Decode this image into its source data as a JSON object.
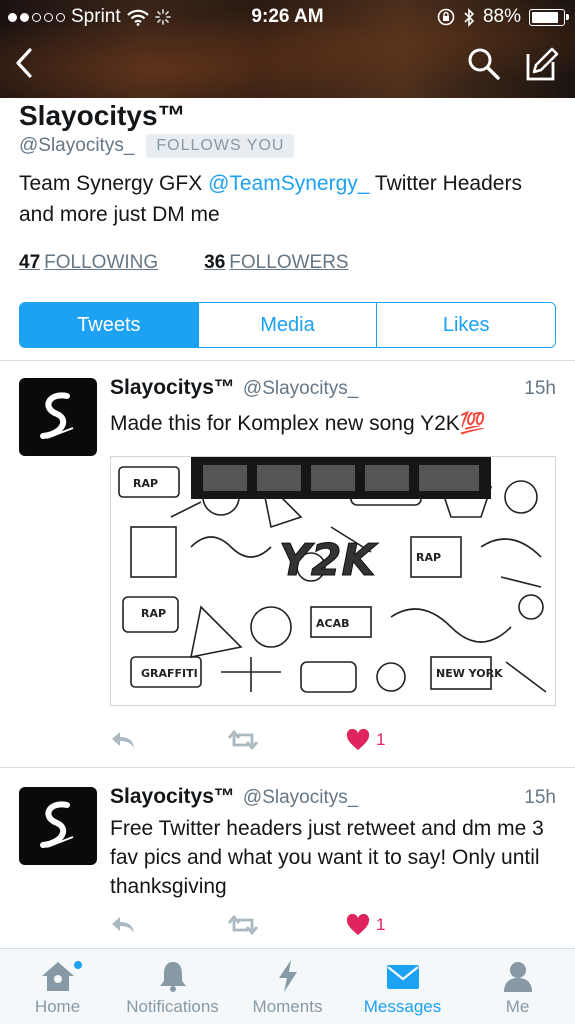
{
  "status_bar": {
    "carrier": "Sprint",
    "time": "9:26 AM",
    "battery": "88%",
    "battery_level": 0.88
  },
  "profile": {
    "display_name": "Slayocitys™",
    "handle": "@Slayocitys_",
    "follows_you_badge": "FOLLOWS YOU",
    "bio_before": "Team Synergy GFX ",
    "bio_mention": "@TeamSynergy_",
    "bio_after": " Twitter Headers and more just DM me",
    "following_count": "47",
    "following_label": "FOLLOWING",
    "followers_count": "36",
    "followers_label": "FOLLOWERS"
  },
  "profile_tabs": {
    "tweets": "Tweets",
    "media": "Media",
    "likes": "Likes"
  },
  "tweets": [
    {
      "name": "Slayocitys™",
      "handle": "@Slayocitys_",
      "time": "15h",
      "text": "Made this for Komplex new song Y2K💯",
      "media_text": "Y2K",
      "likes": "1"
    },
    {
      "name": "Slayocitys™",
      "handle": "@Slayocitys_",
      "time": "15h",
      "text": "Free Twitter headers just retweet and dm me 3 fav pics and what you want it to say! Only until thanksgiving",
      "likes": "1"
    }
  ],
  "tab_bar": {
    "home": "Home",
    "notifications": "Notifications",
    "moments": "Moments",
    "messages": "Messages",
    "me": "Me"
  },
  "colors": {
    "accent": "#1da1f2",
    "like": "#e0245e",
    "muted": "#657786"
  }
}
